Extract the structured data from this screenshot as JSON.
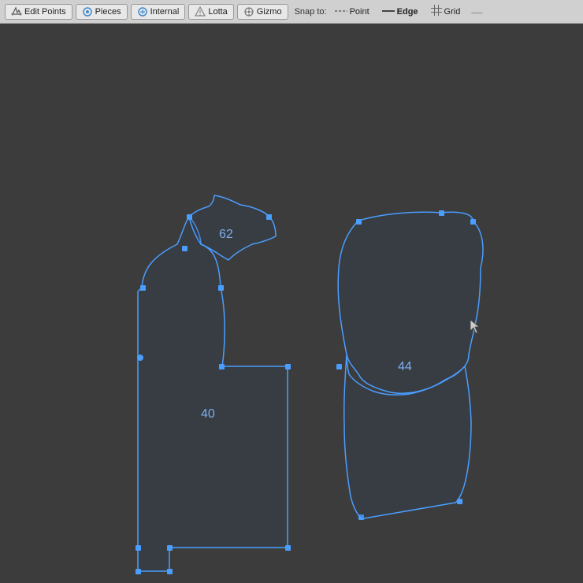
{
  "toolbar": {
    "buttons": [
      {
        "id": "edit-points",
        "label": "Edit Points",
        "icon": "edit-points-icon"
      },
      {
        "id": "pieces",
        "label": "Pieces",
        "icon": "pieces-icon"
      },
      {
        "id": "internal",
        "label": "Internal",
        "icon": "internal-icon"
      },
      {
        "id": "lotta",
        "label": "Lotta",
        "icon": "lotta-icon"
      },
      {
        "id": "gizmo",
        "label": "Gizmo",
        "icon": "gizmo-icon"
      }
    ],
    "snap_label": "Snap to:",
    "snap_options": [
      {
        "id": "point",
        "label": "Point",
        "active": false
      },
      {
        "id": "edge",
        "label": "Edge",
        "active": true
      },
      {
        "id": "grid",
        "label": "Grid",
        "active": false
      }
    ]
  },
  "pieces": [
    {
      "id": "piece-40",
      "label": "40"
    },
    {
      "id": "piece-62",
      "label": "62"
    },
    {
      "id": "piece-44",
      "label": "44"
    }
  ]
}
